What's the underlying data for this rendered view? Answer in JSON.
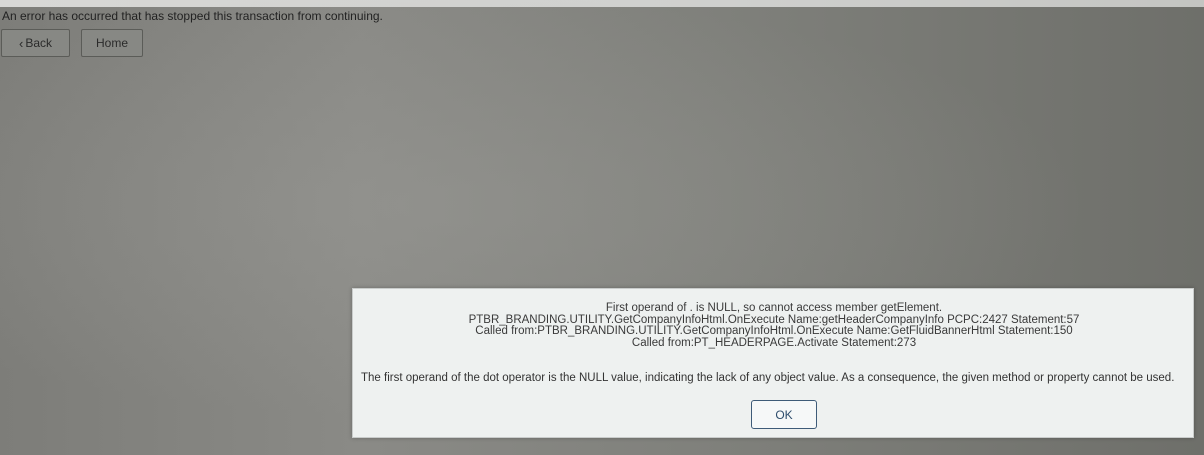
{
  "page": {
    "error_banner": "An error has occurred that has stopped this transaction from continuing."
  },
  "nav": {
    "back_label": "Back",
    "home_label": "Home",
    "back_icon": "chevron-left-icon"
  },
  "dialog": {
    "message_lines": [
      "First operand of . is NULL, so cannot access member getElement.",
      "PTBR_BRANDING.UTILITY.GetCompanyInfoHtml.OnExecute  Name:getHeaderCompanyInfo  PCPC:2427  Statement:57",
      "Called from:PTBR_BRANDING.UTILITY.GetCompanyInfoHtml.OnExecute  Name:GetFluidBannerHtml  Statement:150",
      "Called from:PT_HEADERPAGE.Activate  Statement:273"
    ],
    "explanation": "The first operand of the dot operator is the NULL value, indicating the lack of any object value. As a consequence, the given method or property cannot be used.",
    "ok_label": "OK"
  },
  "colors": {
    "dialog_background": "#eef1f0",
    "ok_border": "#3e5b78",
    "ok_text": "#2e4d6d"
  }
}
